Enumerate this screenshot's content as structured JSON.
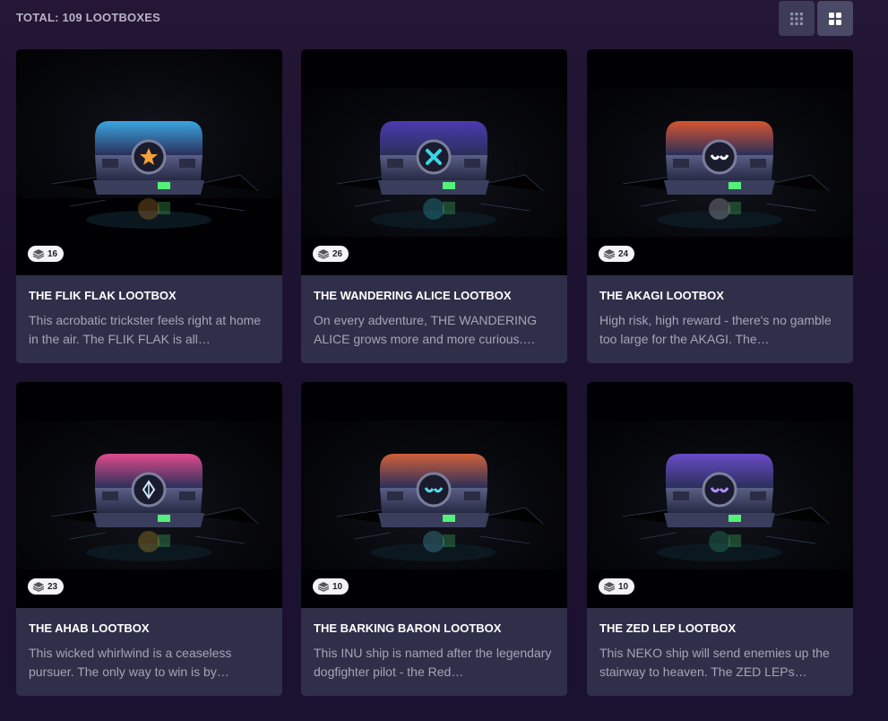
{
  "header": {
    "total_label": "TOTAL: 109 LOOTBOXES",
    "view_small_icon": "grid-small-icon",
    "view_large_icon": "grid-large-icon"
  },
  "cards": [
    {
      "title": "THE FLIK FLAK LOOTBOX",
      "description": "This acrobatic trickster feels right at home in the air. The FLIK FLAK is all…",
      "count": "16",
      "colors": {
        "top": "#3aa6e0",
        "accent": "#f2a13a",
        "emblem": "star"
      }
    },
    {
      "title": "THE WANDERING ALICE LOOTBOX",
      "description": "On every adventure, THE WANDERING ALICE grows more and more curious.…",
      "count": "26",
      "colors": {
        "top": "#4b3bb0",
        "accent": "#39d6e6",
        "emblem": "x"
      }
    },
    {
      "title": "THE AKAGI LOOTBOX",
      "description": "High risk, high reward - there's no gamble too large for the AKAGI. The…",
      "count": "24",
      "colors": {
        "top": "#d8552f",
        "accent": "#e7e2ee",
        "emblem": "face"
      }
    },
    {
      "title": "THE AHAB LOOTBOX",
      "description": "This wicked whirlwind is a ceaseless pursuer. The only way to win is by…",
      "count": "23",
      "colors": {
        "top": "#e04b8c",
        "accent": "#f2c23a",
        "emblem": "diamond"
      }
    },
    {
      "title": "THE BARKING BARON LOOTBOX",
      "description": "This INU ship is named after the legendary dogfighter pilot - the Red…",
      "count": "10",
      "colors": {
        "top": "#d0603a",
        "accent": "#5fd8e8",
        "emblem": "eyes"
      }
    },
    {
      "title": "THE ZED LEP LOOTBOX",
      "description": "This NEKO ship will send enemies up the stairway to heaven. The ZED LEPs…",
      "count": "10",
      "colors": {
        "top": "#6a4bc8",
        "accent": "#38c08f",
        "emblem": "eyes-purple"
      }
    }
  ]
}
